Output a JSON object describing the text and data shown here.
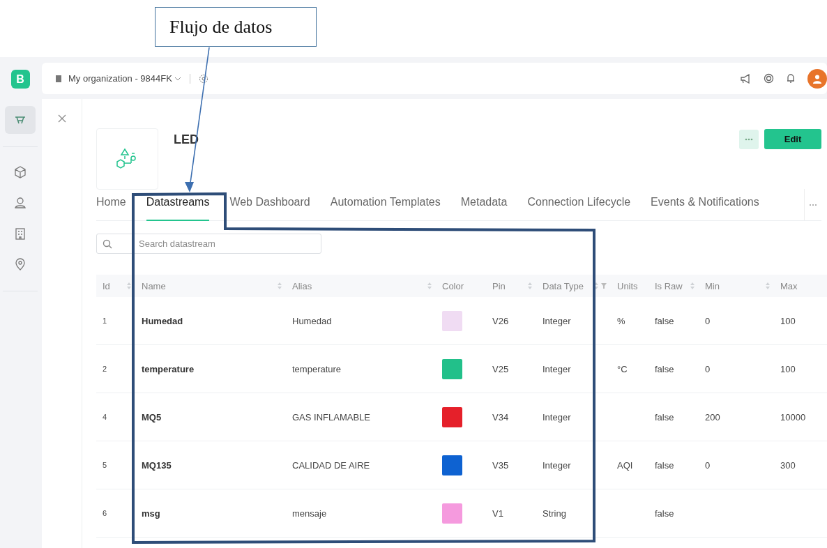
{
  "annotation": {
    "callout": "Flujo de datos"
  },
  "sidebar": {
    "logo": "B",
    "items": [
      {
        "selected": true
      },
      {
        "selected": false
      },
      {
        "selected": false
      },
      {
        "selected": false
      },
      {
        "selected": false
      }
    ]
  },
  "topbar": {
    "organization": "My organization - 9844FK"
  },
  "product": {
    "name": "LED",
    "edit_button": "Edit"
  },
  "tabs": [
    {
      "label": "Home",
      "selected": false
    },
    {
      "label": "Datastreams",
      "selected": true
    },
    {
      "label": "Web Dashboard",
      "selected": false
    },
    {
      "label": "Automation Templates",
      "selected": false
    },
    {
      "label": "Metadata",
      "selected": false
    },
    {
      "label": "Connection Lifecycle",
      "selected": false
    },
    {
      "label": "Events & Notifications",
      "selected": false
    }
  ],
  "search": {
    "placeholder": "Search datastream"
  },
  "table": {
    "columns": [
      {
        "label": "Id",
        "sortable": true,
        "filterable": false
      },
      {
        "label": "Name",
        "sortable": true,
        "filterable": false
      },
      {
        "label": "Alias",
        "sortable": true,
        "filterable": false
      },
      {
        "label": "Color",
        "sortable": false,
        "filterable": false
      },
      {
        "label": "Pin",
        "sortable": true,
        "filterable": false
      },
      {
        "label": "Data Type",
        "sortable": true,
        "filterable": true
      },
      {
        "label": "Units",
        "sortable": false,
        "filterable": false
      },
      {
        "label": "Is Raw",
        "sortable": true,
        "filterable": false
      },
      {
        "label": "Min",
        "sortable": true,
        "filterable": false
      },
      {
        "label": "Max",
        "sortable": false,
        "filterable": false
      }
    ],
    "rows": [
      {
        "id": "1",
        "name": "Humedad",
        "alias": "Humedad",
        "color": "#f0dcf3",
        "pin": "V26",
        "data_type": "Integer",
        "units": "%",
        "is_raw": "false",
        "min": "0",
        "max": "100"
      },
      {
        "id": "2",
        "name": "temperature",
        "alias": "temperature",
        "color": "#22c08a",
        "pin": "V25",
        "data_type": "Integer",
        "units": "°C",
        "is_raw": "false",
        "min": "0",
        "max": "100"
      },
      {
        "id": "4",
        "name": "MQ5",
        "alias": "GAS INFLAMABLE",
        "color": "#e5202a",
        "pin": "V34",
        "data_type": "Integer",
        "is_raw": "false",
        "min": "200",
        "max": "10000"
      },
      {
        "id": "5",
        "name": "MQ135",
        "alias": "CALIDAD DE AIRE",
        "color": "#0e62d1",
        "pin": "V35",
        "data_type": "Integer",
        "units": "AQI",
        "is_raw": "false",
        "min": "0",
        "max": "300"
      },
      {
        "id": "6",
        "name": "msg",
        "alias": "mensaje",
        "color": "#f59ade",
        "pin": "V1",
        "data_type": "String",
        "is_raw": "false"
      }
    ]
  }
}
